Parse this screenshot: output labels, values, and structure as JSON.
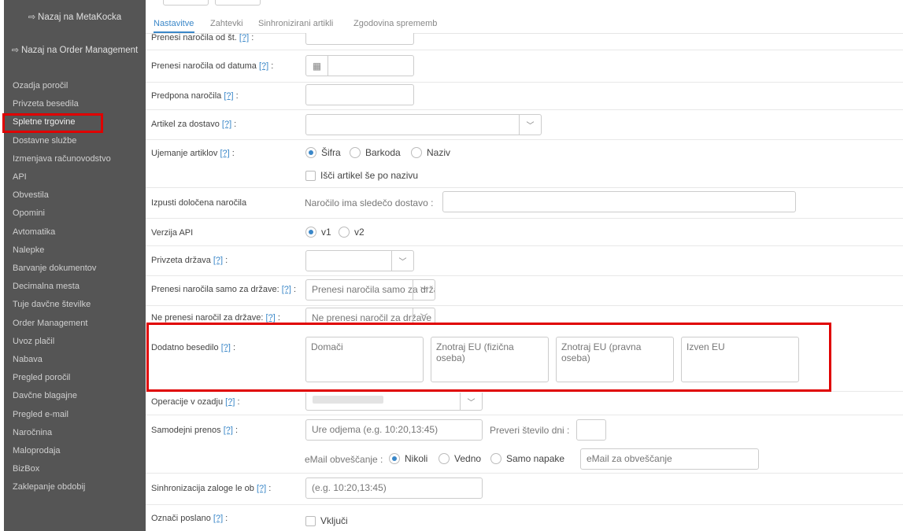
{
  "sidebar": {
    "back_metakocka": "Nazaj na MetaKocka",
    "back_order_mgmt": "Nazaj na Order Management",
    "items": [
      "Ozadja poročil",
      "Privzeta besedila",
      "Spletne trgovine",
      "Dostavne službe",
      "Izmenjava računovodstvo",
      "API",
      "Obvestila",
      "Opomini",
      "Avtomatika",
      "Nalepke",
      "Barvanje dokumentov",
      "Decimalna mesta",
      "Tuje davčne številke",
      "Order Management",
      "Uvoz plačil",
      "Nabava",
      "Pregled poročil",
      "Davčne blagajne",
      "Pregled e-mail",
      "Naročnina",
      "Maloprodaja",
      "BizBox",
      "Zaklepanje obdobij"
    ],
    "highlighted_item": "Spletne trgovine"
  },
  "tabs": [
    "Nastavitve",
    "Zahtevki",
    "Sinhronizirani artikli",
    "Zgodovina sprememb"
  ],
  "help_mark": "[?]",
  "form": {
    "from_number_label": "Prenesi naročila od št.",
    "from_date_label": "Prenesi naročila od datuma",
    "prefix_label": "Predpona naročila",
    "delivery_item_label": "Artikel za dostavo",
    "item_match_label": "Ujemanje artiklov",
    "item_match_options": [
      "Šifra",
      "Barkoda",
      "Naziv"
    ],
    "item_match_selected": "Šifra",
    "search_by_name_label": "Išči artikel še po nazivu",
    "skip_orders_label": "Izpusti določena naročila",
    "skip_orders_text": "Naročilo ima sledečo dostavo :",
    "api_version_label": "Verzija API",
    "api_version_options": [
      "v1",
      "v2"
    ],
    "api_version_selected": "v1",
    "default_country_label": "Privzeta država",
    "only_countries_label": "Prenesi naročila samo za države:",
    "only_countries_placeholder": "Prenesi naročila samo za države",
    "exclude_countries_label": "Ne prenesi naročil za države:",
    "exclude_countries_placeholder": "Ne prenesi naročil za države",
    "extra_text_label": "Dodatno besedilo",
    "extra_text_fields": [
      "Domači",
      "Znotraj EU (fizična oseba)",
      "Znotraj EU (pravna oseba)",
      "Izven EU"
    ],
    "bg_operations_label": "Operacije v ozadju",
    "auto_transfer_label": "Samodejni prenos",
    "auto_transfer_placeholder": "Ure odjema (e.g. 10:20,13:45)",
    "check_days_label": "Preveri število dni :",
    "email_notify_label": "eMail obveščanje :",
    "email_notify_options": [
      "Nikoli",
      "Vedno",
      "Samo napake"
    ],
    "email_notify_selected": "Nikoli",
    "email_placeholder": "eMail za obveščanje",
    "stock_sync_label": "Sinhronizacija zaloge le ob",
    "stock_sync_placeholder": "(e.g. 10:20,13:45)",
    "mark_sent_label": "Označi poslano",
    "mark_sent_checkbox": "Vključi"
  }
}
